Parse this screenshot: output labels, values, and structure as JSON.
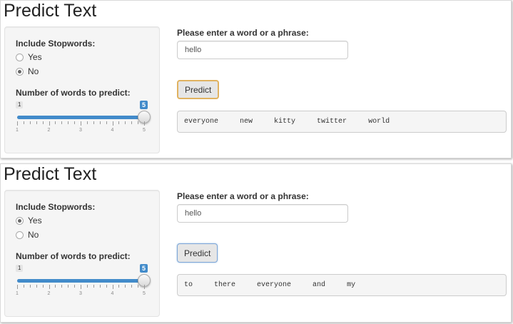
{
  "panels": [
    {
      "title": "Predict Text",
      "stopwords_label": "Include Stopwords:",
      "radio_options": [
        {
          "label": "Yes",
          "selected": false
        },
        {
          "label": "No",
          "selected": true
        }
      ],
      "num_words_label": "Number of words to predict:",
      "slider": {
        "min": 1,
        "max": 5,
        "value": 5,
        "min_label": "1",
        "value_label": "5",
        "ticks": [
          "1",
          "2",
          "3",
          "4",
          "5"
        ]
      },
      "input_label": "Please enter a word or a phrase:",
      "input_value": "hello",
      "button_label": "Predict",
      "predictions": [
        "everyone",
        "new",
        "kitty",
        "twitter",
        "world"
      ]
    },
    {
      "title": "Predict Text",
      "stopwords_label": "Include Stopwords:",
      "radio_options": [
        {
          "label": "Yes",
          "selected": true
        },
        {
          "label": "No",
          "selected": false
        }
      ],
      "num_words_label": "Number of words to predict:",
      "slider": {
        "min": 1,
        "max": 5,
        "value": 5,
        "min_label": "1",
        "value_label": "5",
        "ticks": [
          "1",
          "2",
          "3",
          "4",
          "5"
        ]
      },
      "input_label": "Please enter a word or a phrase:",
      "input_value": "hello",
      "button_label": "Predict",
      "predictions": [
        "to",
        "there",
        "everyone",
        "and",
        "my"
      ]
    }
  ],
  "colors": {
    "accent": "#428bca",
    "button_focus": "#e0b260"
  }
}
